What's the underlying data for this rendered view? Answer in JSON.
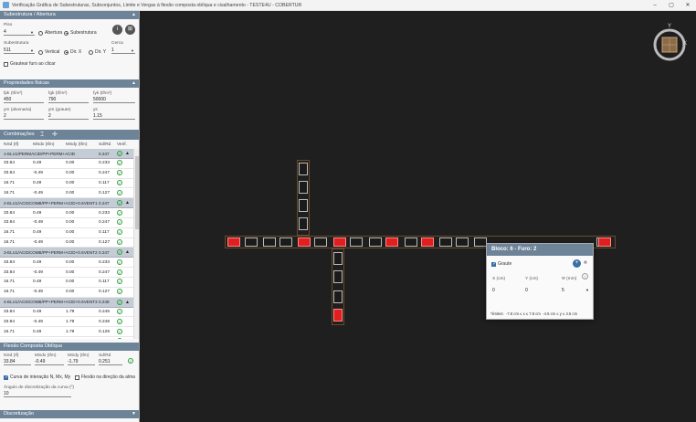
{
  "window": {
    "title": "Verificação Gráfica de Subestruturas, Subconjuntos, Limite e Vergas à flexão composta oblíqua e cisalhamento - TESTE4U - COBERTUR",
    "minimize": "–",
    "maximize": "▢",
    "close": "✕"
  },
  "subestrutura": {
    "header": "Subestrutura / Abertura",
    "piso_label": "Piso",
    "piso_value": "4",
    "radio_abertura": "Abertura",
    "radio_subestrutura": "Subestrutura",
    "info_btn": "i",
    "grid_btn": "⊞",
    "sub_label": "Subestrutura",
    "sub_value": "511",
    "radio_vertical": "Vertical",
    "radio_dirx": "Dir. X",
    "radio_diry": "Dir. Y",
    "cerca_label": "Cerca",
    "cerca_value": "1",
    "grautear_label": "Grautear furo ao clicar"
  },
  "propriedades": {
    "header": "Propriedades físicas",
    "fpk_label": "fpk (tf/m²)",
    "fpk_value": "450",
    "fgk_label": "fgk (tf/m²)",
    "fgk_value": "790",
    "fyk_label": "fyk (tf/m²)",
    "fyk_value": "50000",
    "ym_alv_label": "ym (alvenaria)",
    "ym_alv_value": "2",
    "ym_graute_label": "ym (graute)",
    "ym_graute_value": "2",
    "ys_label": "ys",
    "ys_value": "1.15"
  },
  "combinacoes": {
    "header": "Combinações",
    "col_nsd": "NSd (tf)",
    "col_msdx": "MSdx (tfm)",
    "col_msdy": "MSdy (tfm)",
    "col_sdrd": "Sd/Rd",
    "col_verif": "Verif.",
    "groups": [
      {
        "name": "1-ELU1/PERMACID/PP+PERM+ACID",
        "ratio": "0.247",
        "rows": [
          [
            "33.84",
            "0.49",
            "0.00",
            "0.233"
          ],
          [
            "33.84",
            "-0.49",
            "0.00",
            "0.247"
          ],
          [
            "16.71",
            "0.49",
            "0.00",
            "0.117"
          ],
          [
            "16.71",
            "-0.49",
            "0.00",
            "0.127"
          ]
        ]
      },
      {
        "name": "2-ELU1/ACIDCOMB/PP+PERM+ACID+0.6VENT1",
        "ratio": "0.247",
        "rows": [
          [
            "33.84",
            "0.49",
            "0.00",
            "0.233"
          ],
          [
            "33.84",
            "-0.49",
            "0.00",
            "0.247"
          ],
          [
            "16.71",
            "0.49",
            "0.00",
            "0.117"
          ],
          [
            "16.71",
            "-0.49",
            "0.00",
            "0.127"
          ]
        ]
      },
      {
        "name": "3-ELU1/ACIDCOMB/PP+PERM+ACID+0.6VENT2",
        "ratio": "0.247",
        "rows": [
          [
            "33.84",
            "0.49",
            "0.00",
            "0.233"
          ],
          [
            "33.84",
            "-0.49",
            "0.00",
            "0.247"
          ],
          [
            "16.71",
            "0.49",
            "0.00",
            "0.117"
          ],
          [
            "16.71",
            "-0.49",
            "0.00",
            "0.127"
          ]
        ]
      },
      {
        "name": "4-ELU1/ACIDCOMB/PP+PERM+ACID+0.6VENT3",
        "ratio": "0.248",
        "rows": [
          [
            "33.84",
            "0.49",
            "1.79",
            "0.245"
          ],
          [
            "33.84",
            "-0.49",
            "1.79",
            "0.248"
          ],
          [
            "16.71",
            "0.49",
            "1.79",
            "0.129"
          ],
          [
            "16.71",
            "-0.49",
            "1.79",
            "0.127"
          ]
        ]
      }
    ]
  },
  "flexao": {
    "header": "Flexão Composta Oblíqua",
    "nsd_label": "NSd (tf)",
    "nsd_value": "33.84",
    "msdx_label": "MSdx (tfm)",
    "msdx_value": "-0.49",
    "msdy_label": "MSdy (tfm)",
    "msdy_value": "-1.79",
    "sdrd_label": "Sd/Rd",
    "sdrd_value": "0.251",
    "curva_label": "Curva de interação N, Mx, My",
    "flexao_alma_label": "Flexão na direção da alma",
    "angulo_label": "Ângulo de discretização da curva (º)",
    "angulo_value": "10"
  },
  "discretizacao": {
    "header": "Discretização"
  },
  "popup": {
    "title": "Bloco: 6 - Furo: 2",
    "graute_label": "Graute",
    "x_label": "X (cm)",
    "y_label": "Y (cm)",
    "phi_label": "Φ (mm)",
    "x_value": "0",
    "y_value": "0",
    "phi_value": "5",
    "limits_label": "*limites:",
    "limits_x": "-7.8 cm ≤ x ≤ 7.8 cm",
    "limits_y": "-4.5 cm ≤ y ≤ 4.5 cm"
  },
  "compass": {
    "y": "Y",
    "x": "X"
  },
  "colors": {
    "header": "#6d8398",
    "group_row": "#c4ccd6",
    "canvas_bg": "#1f1f1f",
    "grouted_block": "#e02020",
    "ok_check": "#2e9e3a"
  }
}
